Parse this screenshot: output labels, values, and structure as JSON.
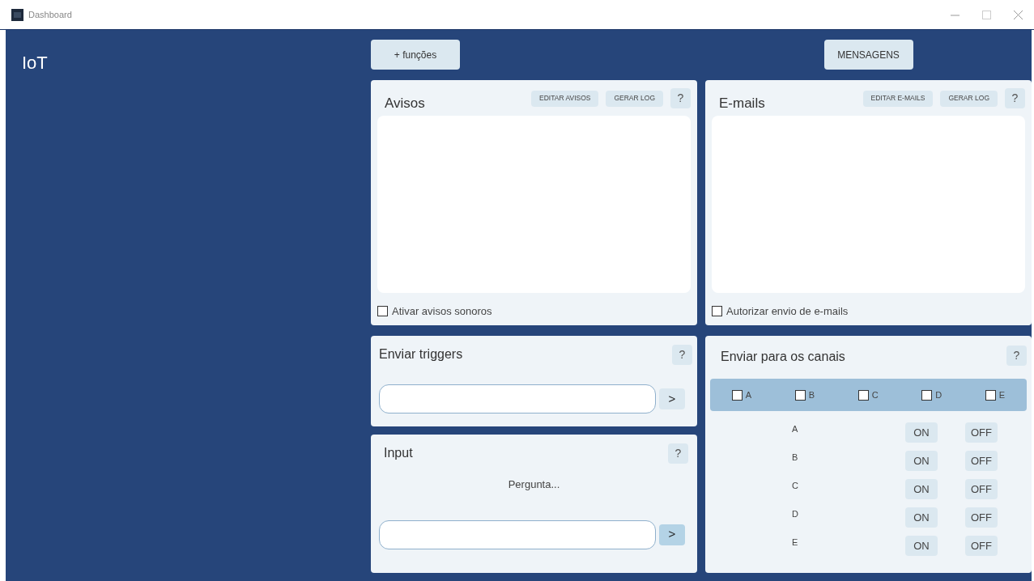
{
  "window": {
    "title": "Dashboard"
  },
  "app_label": "IoT",
  "top_buttons": [
    "+ funções",
    "MENSAGENS"
  ],
  "avisos": {
    "title": "Avisos",
    "buttons": [
      "EDITAR AVISOS",
      "GERAR LOG"
    ],
    "help": "?",
    "checkbox": {
      "label": "Ativar avisos sonoros",
      "checked": false
    }
  },
  "emails": {
    "title": "E-mails",
    "buttons": [
      "EDITAR E-MAILS",
      "GERAR LOG"
    ],
    "help": "?",
    "checkbox": {
      "label": "Autorizar envio de e-mails",
      "checked": false
    }
  },
  "triggers": {
    "title": "Enviar triggers",
    "help": "?",
    "send": {
      "label": ">",
      "highlighted": false
    }
  },
  "input": {
    "title": "Input",
    "help": "?",
    "question": "Pergunta...",
    "send": {
      "label": ">",
      "highlighted": true
    }
  },
  "canais": {
    "title": "Enviar para os canais",
    "help": "?",
    "channel_checks": [
      {
        "label": "A",
        "checked": false
      },
      {
        "label": "B",
        "checked": false
      },
      {
        "label": "C",
        "checked": false
      },
      {
        "label": "D",
        "checked": false
      },
      {
        "label": "E",
        "checked": false
      }
    ],
    "channels": [
      {
        "label": "A",
        "on": "ON",
        "off": "OFF"
      },
      {
        "label": "B",
        "on": "ON",
        "off": "OFF"
      },
      {
        "label": "C",
        "on": "ON",
        "off": "OFF"
      },
      {
        "label": "D",
        "on": "ON",
        "off": "OFF"
      },
      {
        "label": "E",
        "on": "ON",
        "off": "OFF"
      }
    ]
  }
}
